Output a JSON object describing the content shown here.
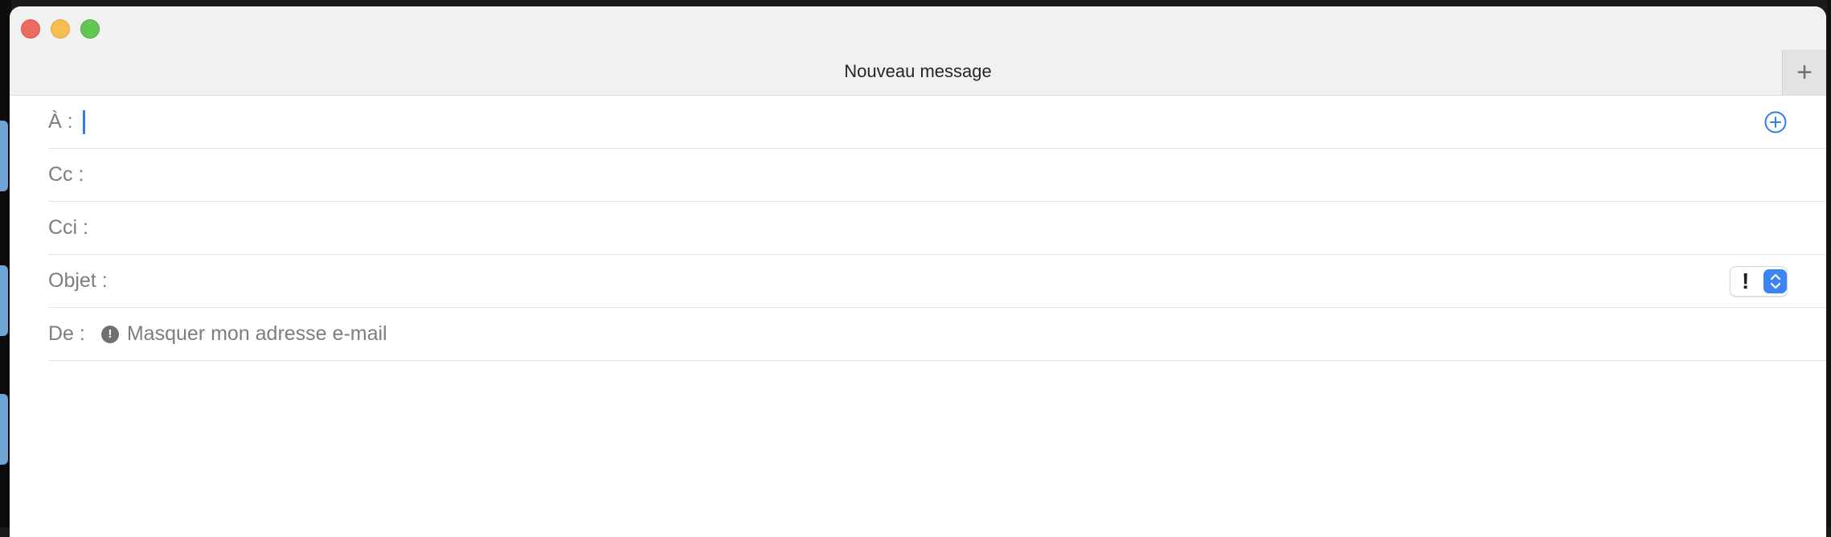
{
  "window": {
    "title": "Nouveau message",
    "new_tab_symbol": "+"
  },
  "fields": {
    "to_label": "À :",
    "cc_label": "Cc :",
    "bcc_label": "Cci :",
    "subject_label": "Objet :",
    "from_label": "De :",
    "from_icon_glyph": "!",
    "from_value": "Masquer mon adresse e-mail",
    "priority_symbol": "!"
  },
  "icons": {
    "add_contact": "plus-circle-icon",
    "from_alert": "alert-circle-icon",
    "priority_stepper": "chevron-up-down-icon"
  },
  "colors": {
    "accent": "#2f7cf6",
    "close": "#ed6a5e",
    "minimize": "#f5bf4f",
    "maximize": "#62c554"
  }
}
